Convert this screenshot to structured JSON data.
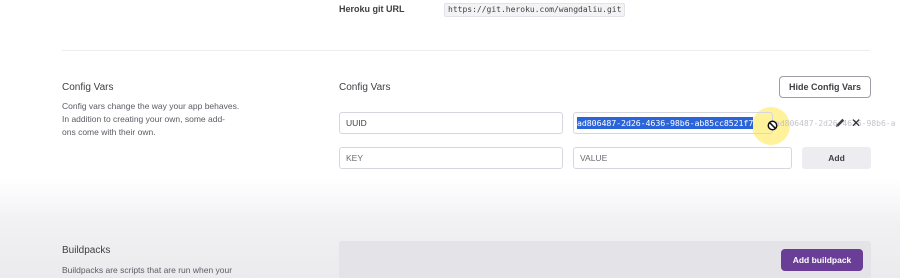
{
  "git": {
    "label": "Heroku git URL",
    "url": "https://git.heroku.com/wangdaliu.git"
  },
  "config_vars": {
    "title": "Config Vars",
    "description_line1": "Config vars change the way your app behaves.",
    "description_line2": "In addition to creating your own, some add-",
    "description_line3": "ons come with their own.",
    "heading": "Config Vars",
    "hide_button": "Hide Config Vars",
    "rows": [
      {
        "key": "UUID",
        "value": "ad806487-2d26-4636-98b6-ab85cc8521f7",
        "value_overflow": "ad806487-2d26-4636-98b6-a"
      }
    ],
    "new_key_placeholder": "KEY",
    "new_value_placeholder": "VALUE",
    "add_button": "Add"
  },
  "buildpacks": {
    "title": "Buildpacks",
    "description_line1": "Buildpacks are scripts that are run when your",
    "add_button": "Add buildpack"
  },
  "colors": {
    "selection": "#2b63d9",
    "cursor_highlight": "#ffee78",
    "buildpack_button": "#6a3e96"
  },
  "icons": {
    "cursor": "forbidden-cursor-icon",
    "edit": "pencil-icon",
    "delete": "close-icon"
  }
}
